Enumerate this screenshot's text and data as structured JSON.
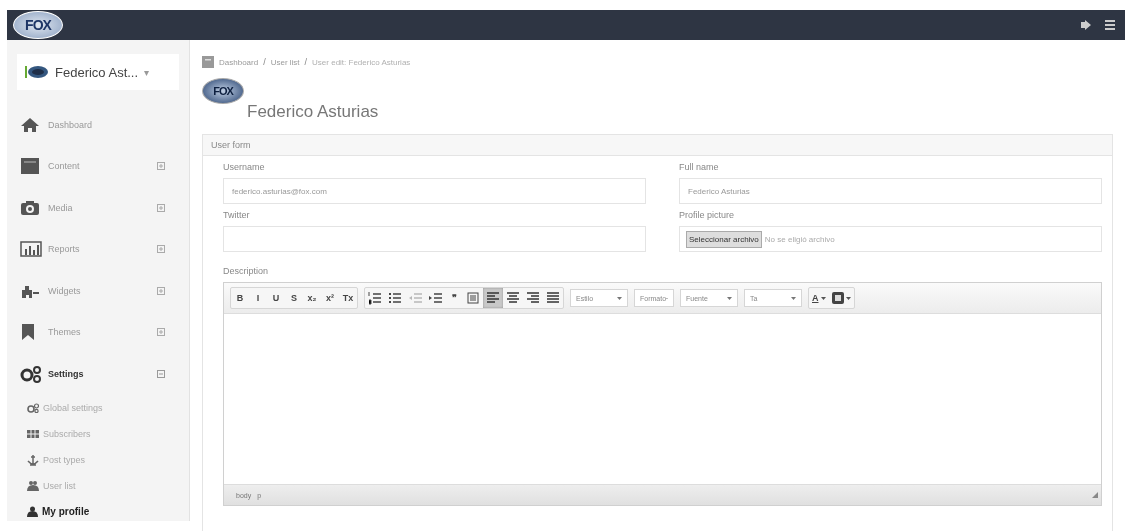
{
  "topbar": {
    "logo": "FOX"
  },
  "sidebar": {
    "user": {
      "name": "Federico Ast...",
      "caret": "▾"
    },
    "items": [
      {
        "label": "Dashboard",
        "kind": "home",
        "expandable": false,
        "expanded": false
      },
      {
        "label": "Content",
        "kind": "content",
        "expandable": true,
        "expanded": false
      },
      {
        "label": "Media",
        "kind": "camera",
        "expandable": true,
        "expanded": false
      },
      {
        "label": "Reports",
        "kind": "chart",
        "expandable": true,
        "expanded": false
      },
      {
        "label": "Widgets",
        "kind": "widgets",
        "expandable": true,
        "expanded": false
      },
      {
        "label": "Themes",
        "kind": "bookmark",
        "expandable": true,
        "expanded": false
      },
      {
        "label": "Settings",
        "kind": "gears",
        "expandable": true,
        "expanded": true,
        "children": [
          {
            "label": "Global settings",
            "kind": "gears",
            "selected": false
          },
          {
            "label": "Subscribers",
            "kind": "grid",
            "selected": false
          },
          {
            "label": "Post types",
            "kind": "anchor",
            "selected": false
          },
          {
            "label": "User list",
            "kind": "users",
            "selected": false
          },
          {
            "label": "My profile",
            "kind": "user",
            "selected": true
          }
        ]
      }
    ]
  },
  "breadcrumb": [
    {
      "kind": "link",
      "text": "Dashboard"
    },
    {
      "kind": "separator",
      "text": "/"
    },
    {
      "kind": "link",
      "text": "User list"
    },
    {
      "kind": "separator",
      "text": "/"
    },
    {
      "kind": "current",
      "text": "User edit: Federico Asturias"
    }
  ],
  "page_logo": "FOX",
  "page_title": "Federico Asturias",
  "panel": {
    "title": "User form",
    "fields": [
      {
        "label": "Username",
        "value": "federico.asturias@fox.com",
        "kind": "text"
      },
      {
        "label": "Full name",
        "value": "Federico Asturias",
        "kind": "text"
      },
      {
        "label": "Twitter",
        "kind": "text"
      },
      {
        "label": "Profile picture",
        "button": "Seleccionar archivo",
        "status": "No se eligió archivo",
        "kind": "file"
      }
    ],
    "description": {
      "label": "Description",
      "toolbar": [
        [
          {
            "kind": "text",
            "text": "B",
            "selected": false
          },
          {
            "kind": "text",
            "text": "I",
            "selected": false
          },
          {
            "kind": "text",
            "text": "U",
            "selected": false
          },
          {
            "kind": "text",
            "text": "S",
            "selected": false
          },
          {
            "kind": "text",
            "text": "x₂",
            "selected": false
          },
          {
            "kind": "text",
            "text": "x²",
            "selected": false
          },
          {
            "kind": "text",
            "text": "Tx",
            "selected": false
          }
        ],
        [
          {
            "kind": "numbered-list",
            "selected": false
          },
          {
            "kind": "bullet-list",
            "selected": false
          },
          {
            "kind": "outdent",
            "selected": false,
            "disabled": true
          },
          {
            "kind": "indent",
            "selected": false,
            "disabled": false
          },
          {
            "kind": "text",
            "text": "❞",
            "selected": false
          },
          {
            "kind": "block",
            "selected": false
          },
          {
            "kind": "align-left",
            "selected": true
          },
          {
            "kind": "align-center",
            "selected": false
          },
          {
            "kind": "align-right",
            "selected": false
          },
          {
            "kind": "justify",
            "selected": false
          }
        ]
      ],
      "dropdowns": [
        "Estilo",
        "Formato",
        "Fuente",
        "Ta"
      ],
      "color_buttons": [
        {
          "text": "A",
          "kind": "text-color"
        },
        {
          "kind": "background-color"
        }
      ],
      "path": [
        "body",
        "p"
      ]
    }
  }
}
